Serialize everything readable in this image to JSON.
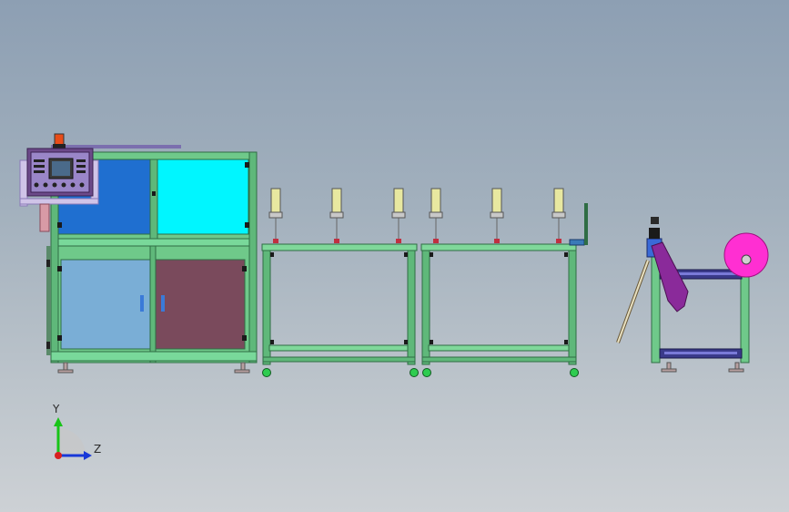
{
  "triad": {
    "y_label": "Y",
    "z_label": "Z"
  },
  "colors": {
    "frame": "#6fc98a",
    "frame_dark": "#2f6d44",
    "door_blue": "#1f6fd0",
    "door_cyan": "#00f6ff",
    "door_lightblue": "#7aaed6",
    "door_mauve": "#7a4a5c",
    "magenta": "#ff2fd2",
    "purple": "#8a2a9a",
    "navy": "#3a3a8a",
    "axis_y": "#18c418",
    "axis_z": "#1838d8",
    "axis_x": "#d82020"
  }
}
